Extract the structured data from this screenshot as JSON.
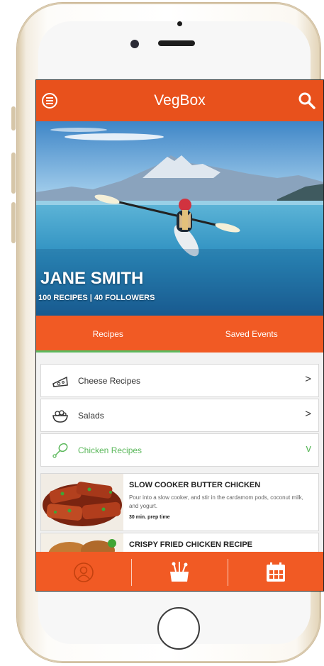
{
  "app": {
    "title": "VegBox"
  },
  "profile": {
    "name": "JANE SMITH",
    "stats": "100 RECIPES  |  40 FOLLOWERS"
  },
  "tabs": [
    {
      "label": "Recipes",
      "active": true
    },
    {
      "label": "Saved Events",
      "active": false
    }
  ],
  "categories": [
    {
      "label": "Cheese Recipes",
      "icon": "cheese-icon",
      "chevron": ">"
    },
    {
      "label": "Salads",
      "icon": "salad-bowl-icon",
      "chevron": ">"
    },
    {
      "label": "Chicken Recipes",
      "icon": "chicken-leg-icon",
      "chevron": "v",
      "expanded": true
    }
  ],
  "recipes": [
    {
      "title": "SLOW COOKER BUTTER CHICKEN",
      "description": "Pour into a slow cooker, and stir in the cardamom pods, coconut milk, and yogurt.",
      "time": "30 min. prep time"
    },
    {
      "title": "CRISPY FRIED CHICKEN RECIPE",
      "description": "",
      "time": ""
    }
  ],
  "bottom_nav": [
    {
      "icon": "profile-icon"
    },
    {
      "icon": "food-bowl-icon"
    },
    {
      "icon": "calendar-icon"
    }
  ],
  "colors": {
    "accent": "#f15a24",
    "appbar": "#e8511c",
    "active_tab_indicator": "#5cb85c",
    "expanded_category": "#5cb85c"
  }
}
